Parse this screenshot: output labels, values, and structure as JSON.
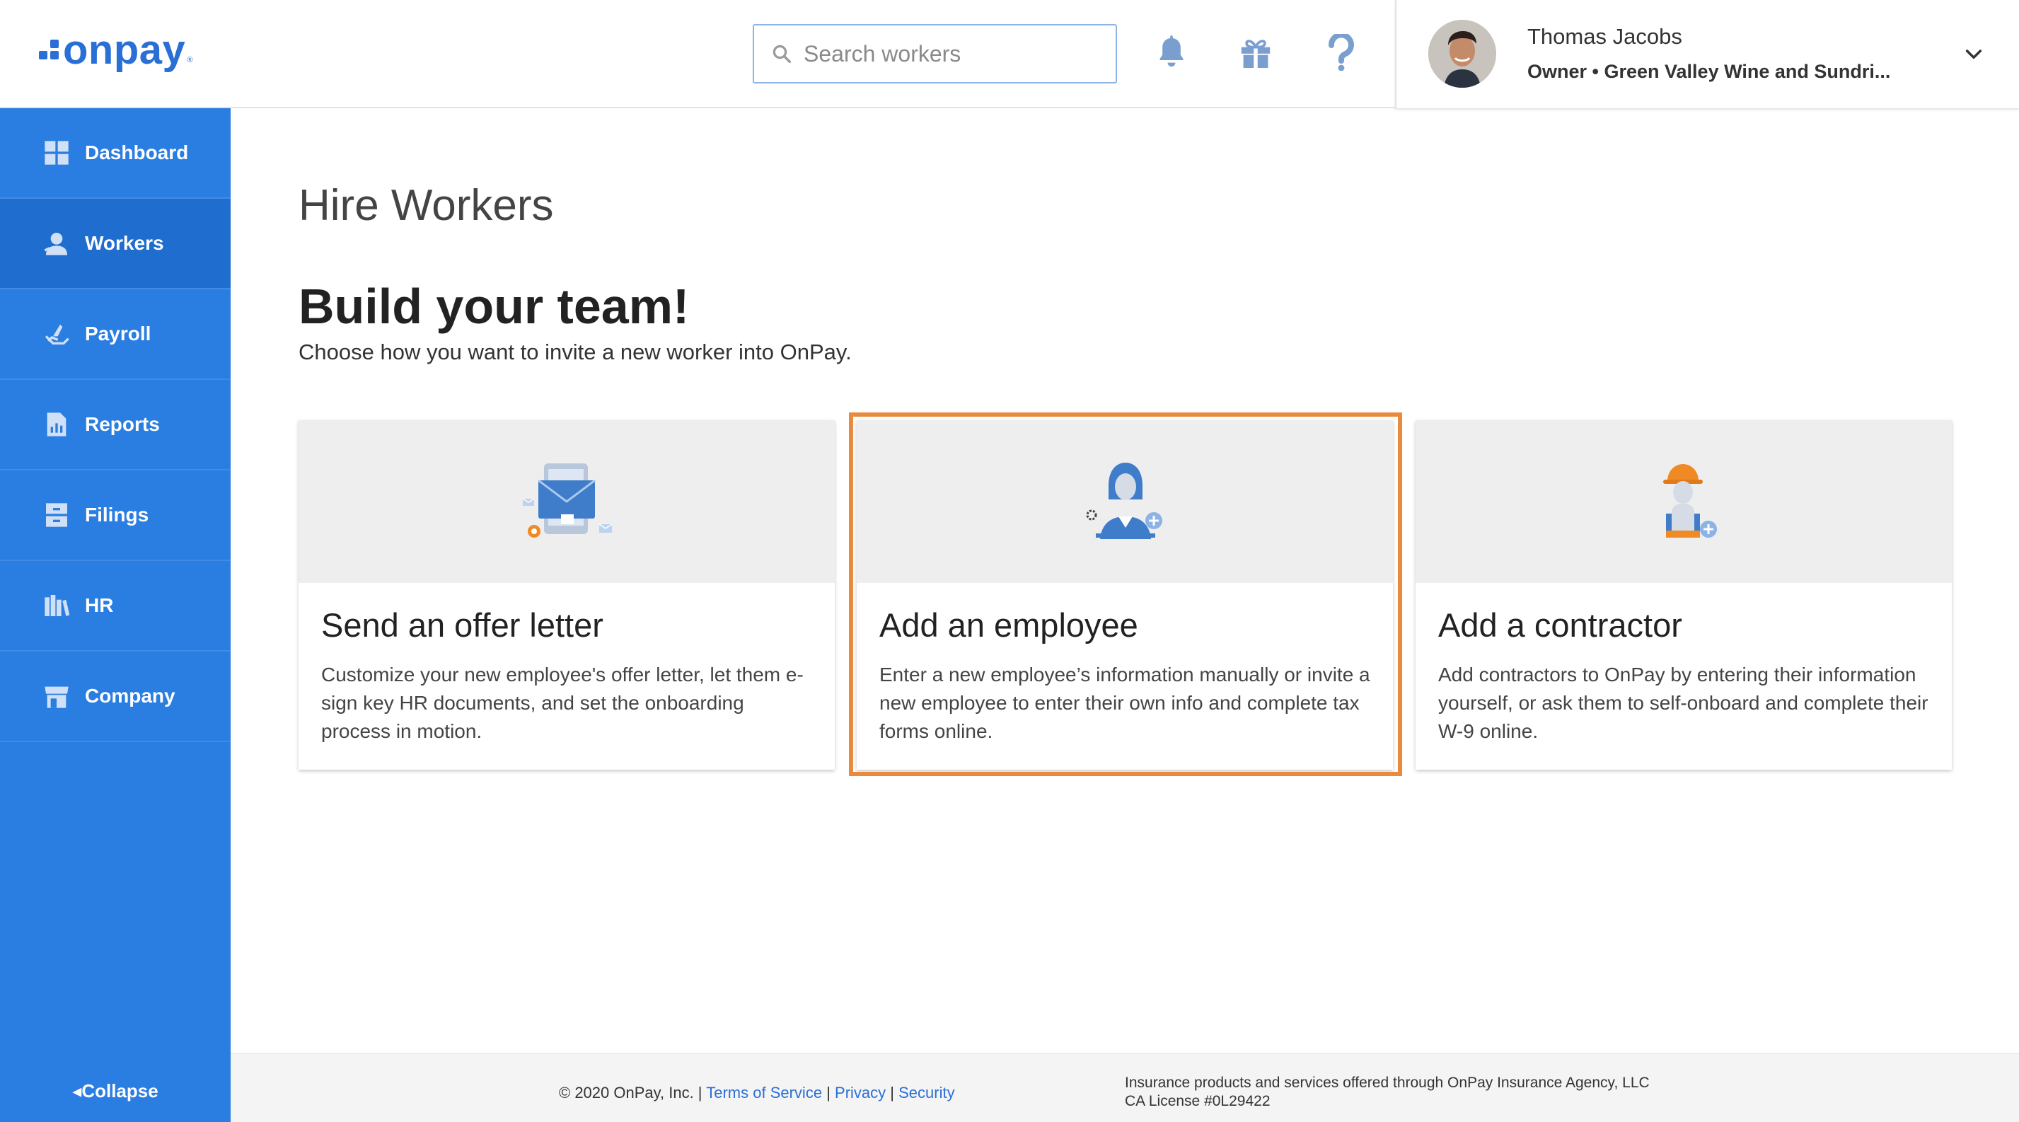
{
  "header": {
    "logo_text": "onpay",
    "logo_mark": "®",
    "search_placeholder": "Search workers",
    "icons": [
      "bell-icon",
      "gift-icon",
      "help-icon"
    ],
    "user": {
      "name": "Thomas Jacobs",
      "role": "Owner • Green Valley Wine and Sundri..."
    }
  },
  "sidebar": {
    "items": [
      {
        "label": "Dashboard",
        "icon": "dashboard-grid-icon"
      },
      {
        "label": "Workers",
        "icon": "workers-icon",
        "active": true
      },
      {
        "label": "Payroll",
        "icon": "payroll-hand-icon"
      },
      {
        "label": "Reports",
        "icon": "reports-document-icon"
      },
      {
        "label": "Filings",
        "icon": "filings-cabinet-icon"
      },
      {
        "label": "HR",
        "icon": "hr-books-icon"
      },
      {
        "label": "Company",
        "icon": "company-store-icon"
      }
    ],
    "collapse_label": "Collapse"
  },
  "main": {
    "page_title": "Hire Workers",
    "heading": "Build your team!",
    "subheading": "Choose how you want to invite a new worker into OnPay.",
    "cards": [
      {
        "title": "Send an offer letter",
        "description": "Customize your new employee's offer letter, let them e-sign key HR documents, and set the onboarding process in motion."
      },
      {
        "title": "Add an employee",
        "description": "Enter a new employee’s information manually or invite a new employee to enter their own info and complete tax forms online.",
        "highlighted": true
      },
      {
        "title": "Add a contractor",
        "description": "Add contractors to OnPay by entering their information yourself, or ask them to self-onboard and complete their W-9 online."
      }
    ]
  },
  "footer": {
    "copyright": "© 2020 OnPay, Inc. |",
    "terms": "Terms of Service",
    "sep1": "|",
    "privacy": "Privacy",
    "sep2": "|",
    "security": "Security",
    "insurance_line1": "Insurance products and services offered through OnPay Insurance Agency, LLC",
    "insurance_line2": "CA License #0L29422"
  },
  "colors": {
    "brand_blue": "#2a7de1",
    "highlight_orange": "#e98a3c"
  }
}
